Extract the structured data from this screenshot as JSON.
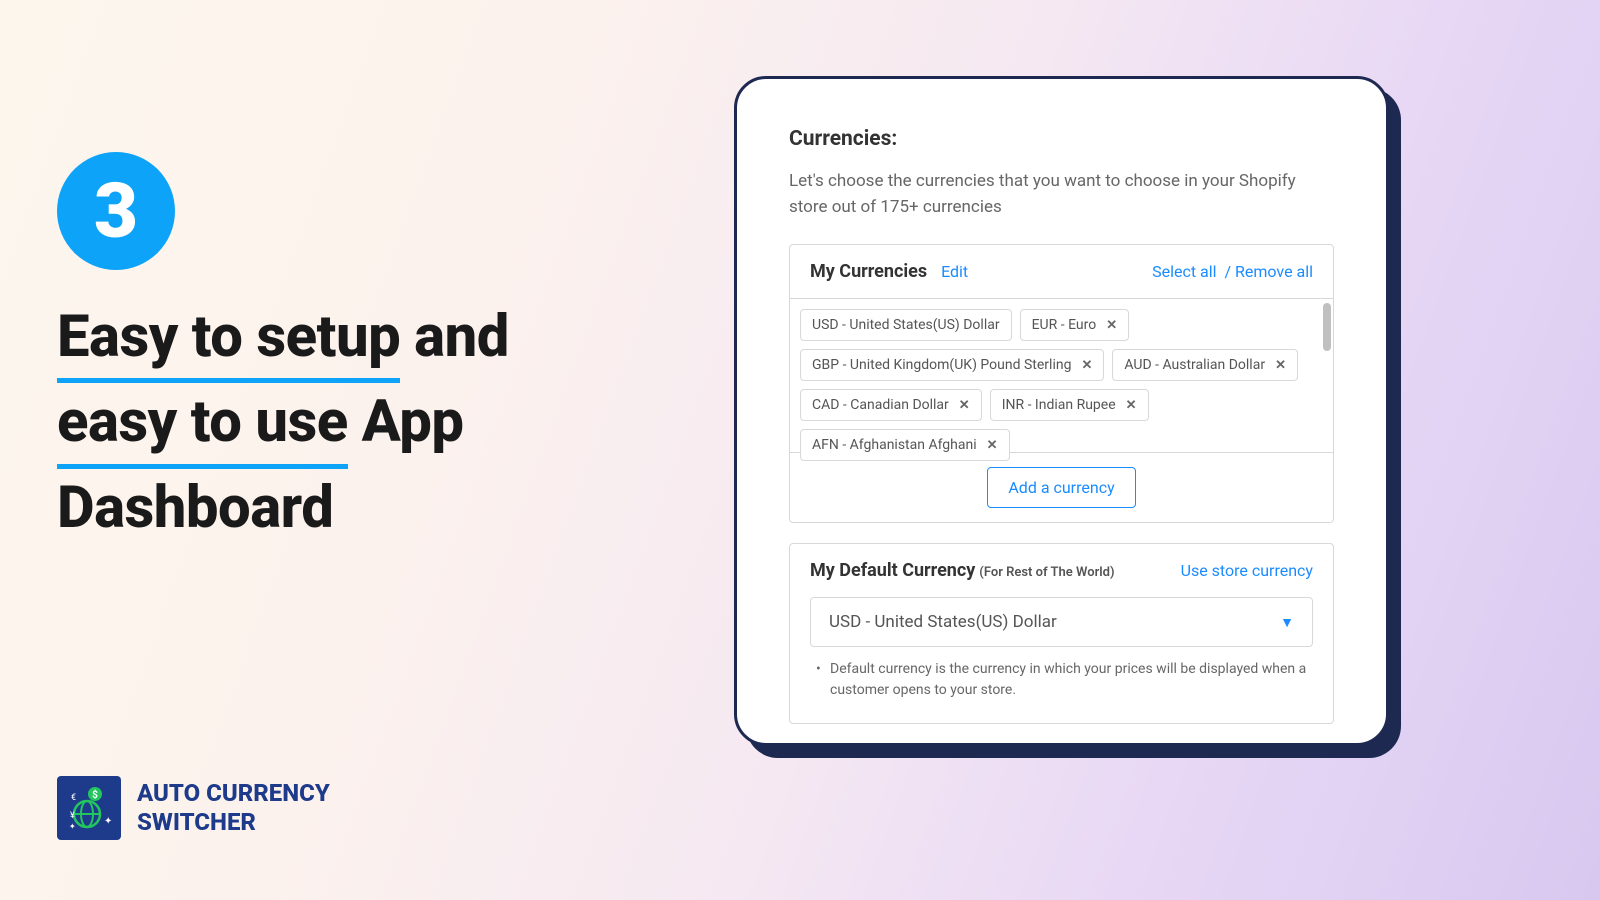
{
  "step_number": "3",
  "headline": {
    "part1": "Easy to setup",
    "part2": "and",
    "part3": "easy to use",
    "part4": "App",
    "part5": "Dashboard"
  },
  "brand": {
    "line1": "AUTO CURRENCY",
    "line2": "SWITCHER"
  },
  "panel": {
    "title": "Currencies:",
    "description": "Let's choose the currencies that you want to choose in your Shopify store out of 175+ currencies",
    "my_currencies": {
      "label": "My Currencies",
      "edit": "Edit",
      "select_all": "Select all",
      "separator": "/",
      "remove_all": "Remove all",
      "tags": [
        "USD - United States(US) Dollar",
        "EUR - Euro",
        "GBP - United Kingdom(UK) Pound Sterling",
        "AUD - Australian Dollar",
        "CAD - Canadian Dollar",
        "INR - Indian Rupee",
        "AFN - Afghanistan Afghani"
      ],
      "add_button": "Add a currency"
    },
    "default_currency": {
      "label": "My Default Currency",
      "sublabel": "(For Rest of The World)",
      "use_store": "Use store currency",
      "selected": "USD - United States(US) Dollar",
      "help": "Default currency is the currency in which your prices will be displayed when a customer opens to your store."
    }
  }
}
